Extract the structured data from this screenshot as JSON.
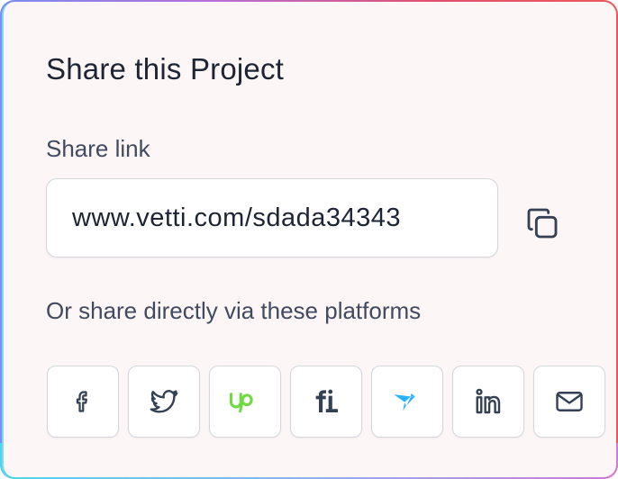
{
  "dialog": {
    "title": "Share this Project",
    "share_link_label": "Share link",
    "share_link_value": "www.vetti.com/sdada34343",
    "platforms_label": "Or share directly via these platforms"
  },
  "platforms": [
    {
      "name": "facebook",
      "icon": "facebook-icon",
      "color": "#344054"
    },
    {
      "name": "twitter",
      "icon": "twitter-icon",
      "color": "#344054"
    },
    {
      "name": "upwork",
      "icon": "upwork-icon",
      "color": "#6fda44"
    },
    {
      "name": "fiverr",
      "icon": "fiverr-icon",
      "color": "#344054"
    },
    {
      "name": "freelancer",
      "icon": "freelancer-icon",
      "color": "#29b2fe"
    },
    {
      "name": "linkedin",
      "icon": "linkedin-icon",
      "color": "#344054"
    },
    {
      "name": "email",
      "icon": "mail-icon",
      "color": "#344054"
    }
  ],
  "colors": {
    "card_background": "#fdf6f6",
    "text_primary": "#1d2433",
    "text_secondary": "#414a5e",
    "border": "#d4d7de"
  }
}
